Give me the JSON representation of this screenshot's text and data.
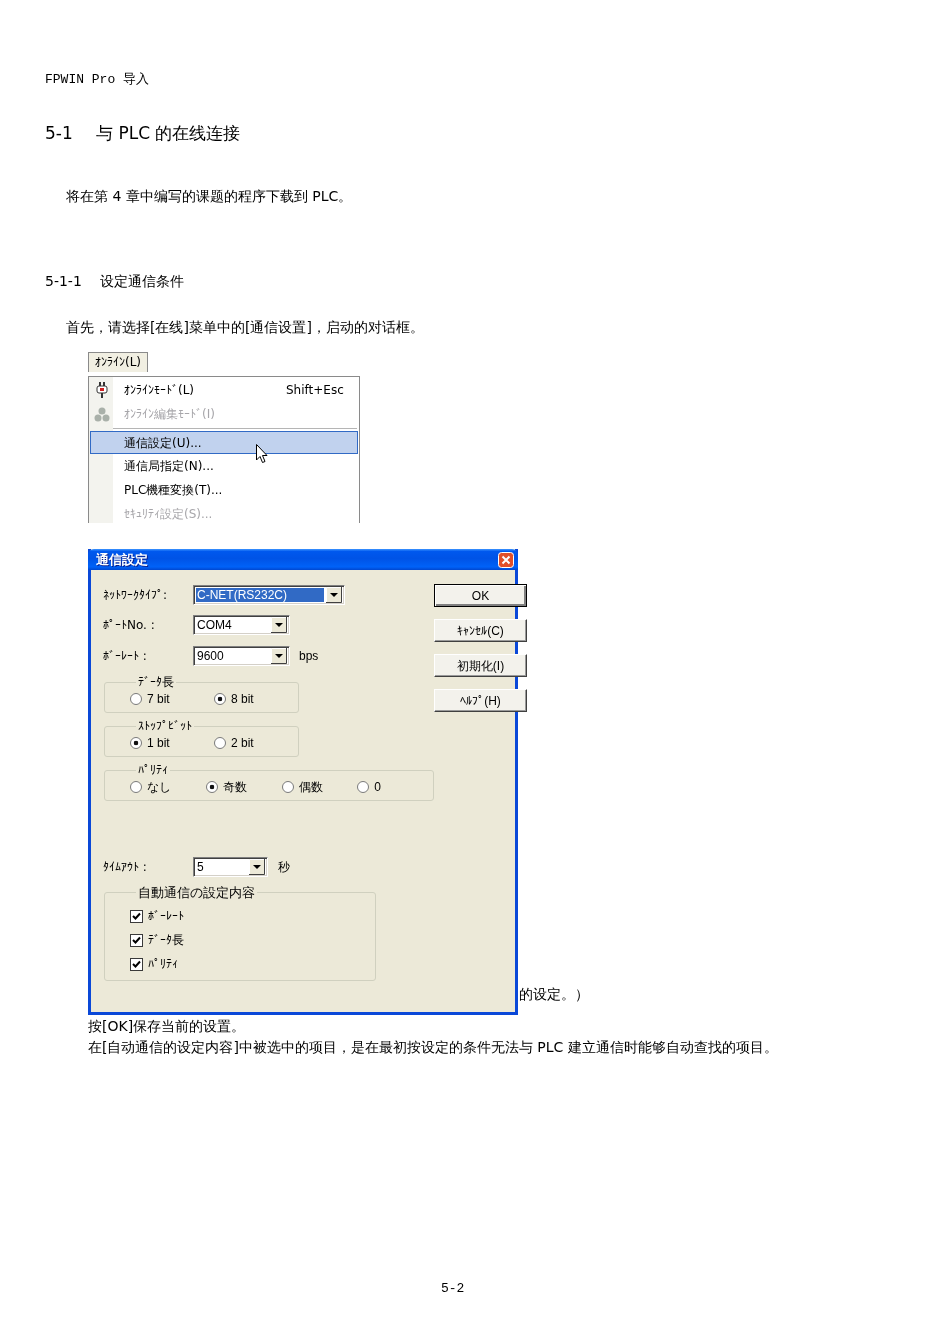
{
  "header": "FPWIN Pro 导入",
  "section": {
    "number": "5-1",
    "title": "与 PLC 的在线连接"
  },
  "intro": "将在第 4 章中编写的课题的程序下载到 PLC。",
  "subsection": {
    "number": "5-1-1",
    "title": "设定通信条件"
  },
  "instruction": "首先，请选择[在线]菜单中的[通信设置]，启动的对话框。",
  "menu": {
    "title": "ｵﾝﾗｲﾝ(L)",
    "items": [
      {
        "kind": "icon_item",
        "label": "ｵﾝﾗｲﾝﾓｰﾄﾞ(L)",
        "shortcut": "Shift+Esc",
        "disabled": false,
        "selected": false
      },
      {
        "kind": "icon_item",
        "label": "ｵﾝﾗｲﾝ編集ﾓｰﾄﾞ(I)",
        "disabled": true,
        "selected": false
      },
      {
        "kind": "separator"
      },
      {
        "kind": "item",
        "label": "通信設定(U)...",
        "disabled": false,
        "selected": true
      },
      {
        "kind": "item",
        "label": "通信局指定(N)...",
        "disabled": false,
        "selected": false
      },
      {
        "kind": "item",
        "label": "PLC機種変換(T)...",
        "disabled": false,
        "selected": false
      },
      {
        "kind": "item",
        "label": "ｾｷｭﾘﾃｨ設定(S)...",
        "disabled": true,
        "selected": false
      }
    ]
  },
  "dialog": {
    "title": "通信設定",
    "fields": [
      {
        "label": "ﾈｯﾄﾜｰｸﾀｲﾌﾟ:",
        "value": "C-NET(RS232C)",
        "focused": true
      },
      {
        "label": "ﾎﾟｰﾄNo. :",
        "value": "COM4",
        "focused": false
      },
      {
        "label": "ﾎﾞｰﾚｰﾄ :",
        "value": "9600",
        "unit": "bps",
        "focused": false
      }
    ],
    "buttons": [
      {
        "label": "OK",
        "default": true
      },
      {
        "label": "ｷｬﾝｾﾙ(C)",
        "default": false
      },
      {
        "label": "初期化(I)",
        "default": false
      },
      {
        "label": "ﾍﾙﾌﾟ(H)",
        "default": false
      }
    ],
    "radio_groups": [
      {
        "title": "ﾃﾞｰﾀ長",
        "options": [
          {
            "label": "7 bit",
            "selected": false
          },
          {
            "label": "8 bit",
            "selected": true
          }
        ]
      },
      {
        "title": "ｽﾄｯﾌﾟﾋﾞｯﾄ",
        "options": [
          {
            "label": "1 bit",
            "selected": true
          },
          {
            "label": "2 bit",
            "selected": false
          }
        ]
      },
      {
        "title": "ﾊﾟﾘﾃｨ",
        "options": [
          {
            "label": "なし",
            "selected": false
          },
          {
            "label": "奇数",
            "selected": true
          },
          {
            "label": "偶数",
            "selected": false
          },
          {
            "label": "0",
            "selected": false
          }
        ]
      }
    ],
    "timeout": {
      "label": "ﾀｲﾑｱｳﾄ :",
      "value": "5",
      "unit": "秒"
    },
    "auto_settings": {
      "title": "自動通信の設定内容",
      "options": [
        {
          "label": "ﾎﾞｰﾚｰﾄ",
          "checked": true
        },
        {
          "label": "ﾃﾞｰﾀ長",
          "checked": true
        },
        {
          "label": "ﾊﾟﾘﾃｨ",
          "checked": true
        }
      ]
    }
  },
  "notes": [
    "的设定。）",
    "按[OK]保存当前的设置。",
    "在[自动通信的设定内容]中被选中的项目，是在最初按设定的条件无法与 PLC 建立通信时能够自动查找的项目。"
  ],
  "page_number": "5-2"
}
